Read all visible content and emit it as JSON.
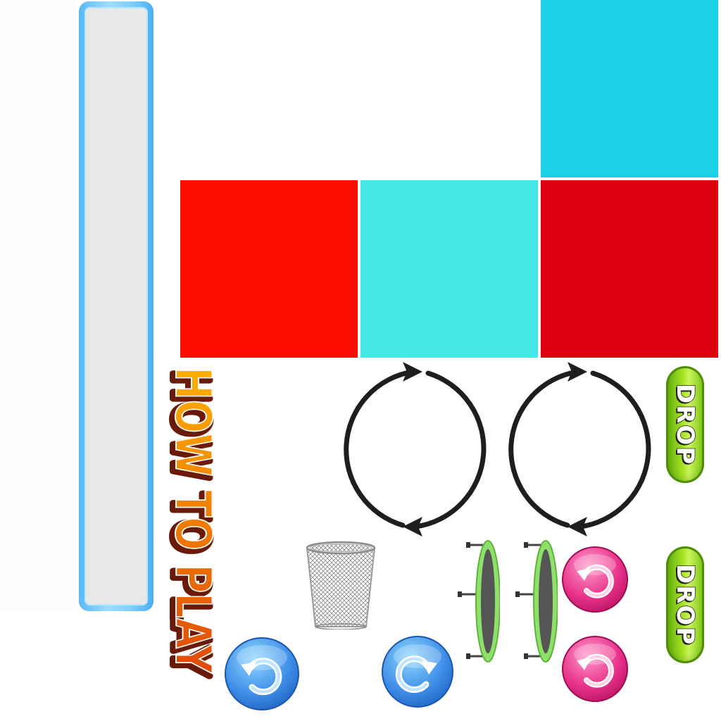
{
  "title": {
    "text": "HOW TO PLAY",
    "fill_top": "#ffb000",
    "fill_bottom": "#e04a0a",
    "outline": "#6a1a08"
  },
  "tiles": [
    {
      "name": "tile-cyan-top",
      "color": "#1ad1e6"
    },
    {
      "name": "tile-red-1",
      "color": "#fb0d00"
    },
    {
      "name": "tile-cyan-2",
      "color": "#45e7e7"
    },
    {
      "name": "tile-red-3",
      "color": "#de000e"
    }
  ],
  "buttons": {
    "drop_1": "DROP",
    "drop_2": "DROP"
  },
  "colors": {
    "panel_frame": "#5ab8f4",
    "panel_fill": "#e8e8e8",
    "drop_green": "#a7e426",
    "blue_button": "#3f8fe8",
    "pink_button": "#e8328a",
    "trampoline_rim": "#8fe06a",
    "trampoline_mat": "#555555",
    "arrow_color": "#1e1e1e"
  },
  "icons": {
    "undo_blue": "undo-arrow-icon",
    "redo_blue": "redo-arrow-icon",
    "reset_pink": "reset-arrow-icon",
    "rotate": "rotate-circle-arrows-icon",
    "basket": "trash-basket-icon",
    "trampoline": "trampoline-icon"
  }
}
